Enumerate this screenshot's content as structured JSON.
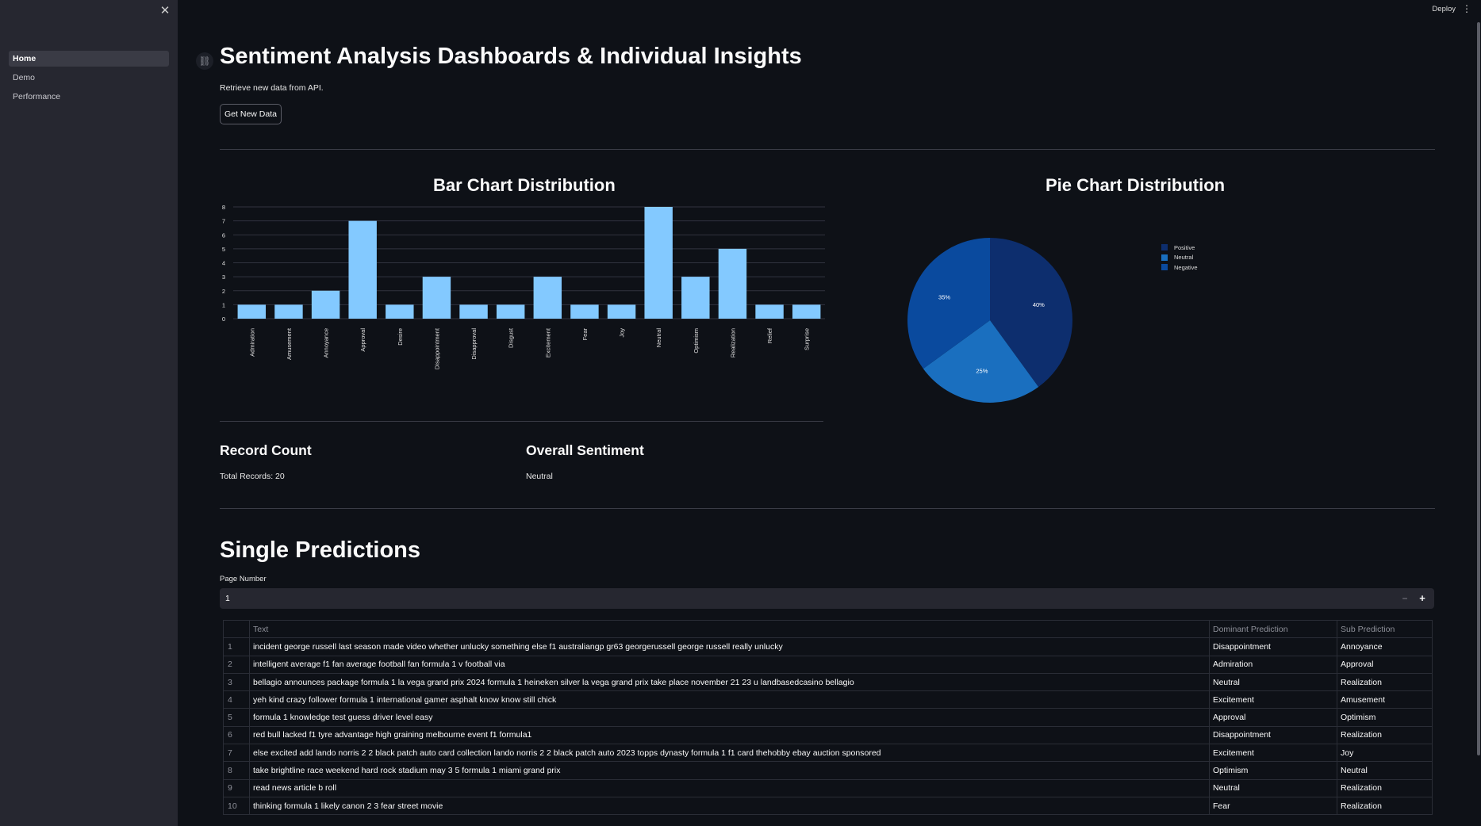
{
  "sidebar": {
    "items": [
      {
        "label": "Home",
        "active": true
      },
      {
        "label": "Demo",
        "active": false
      },
      {
        "label": "Performance",
        "active": false
      }
    ]
  },
  "topbar": {
    "deploy_label": "Deploy"
  },
  "header": {
    "title": "Sentiment Analysis Dashboards & Individual Insights",
    "subtitle": "Retrieve new data from API.",
    "button_label": "Get New Data"
  },
  "bar_chart_title": "Bar Chart Distribution",
  "pie_chart_title": "Pie Chart Distribution",
  "record_count": {
    "heading": "Record Count",
    "text": "Total Records: 20"
  },
  "overall_sentiment": {
    "heading": "Overall Sentiment",
    "text": "Neutral"
  },
  "single_predictions": {
    "heading": "Single Predictions",
    "page_label": "Page Number",
    "page_value": "1",
    "columns": [
      "Text",
      "Dominant Prediction",
      "Sub Prediction"
    ],
    "rows": [
      {
        "idx": "1",
        "text": "incident george russell last season made video whether unlucky something else f1 australiangp gr63 georgerussell george russell really unlucky",
        "dominant": "Disappointment",
        "sub": "Annoyance"
      },
      {
        "idx": "2",
        "text": "intelligent average f1 fan average football fan formula 1 v football via",
        "dominant": "Admiration",
        "sub": "Approval"
      },
      {
        "idx": "3",
        "text": "bellagio announces package formula 1 la vega grand prix 2024 formula 1 heineken silver la vega grand prix take place november 21 23 u landbasedcasino bellagio",
        "dominant": "Neutral",
        "sub": "Realization"
      },
      {
        "idx": "4",
        "text": "yeh kind crazy follower formula 1 international gamer asphalt know know still chick",
        "dominant": "Excitement",
        "sub": "Amusement"
      },
      {
        "idx": "5",
        "text": "formula 1 knowledge test guess driver level easy",
        "dominant": "Approval",
        "sub": "Optimism"
      },
      {
        "idx": "6",
        "text": "red bull lacked f1 tyre advantage high graining melbourne event f1 formula1",
        "dominant": "Disappointment",
        "sub": "Realization"
      },
      {
        "idx": "7",
        "text": "else excited add lando norris 2 2 black patch auto card collection lando norris 2 2 black patch auto 2023 topps dynasty formula 1 f1 card thehobby ebay auction sponsored",
        "dominant": "Excitement",
        "sub": "Joy"
      },
      {
        "idx": "8",
        "text": "take brightline race weekend hard rock stadium may 3 5 formula 1 miami grand prix",
        "dominant": "Optimism",
        "sub": "Neutral"
      },
      {
        "idx": "9",
        "text": "read news article b roll",
        "dominant": "Neutral",
        "sub": "Realization"
      },
      {
        "idx": "10",
        "text": "thinking formula 1 likely canon 2 3 fear street movie",
        "dominant": "Fear",
        "sub": "Realization"
      }
    ]
  },
  "chart_data": [
    {
      "type": "bar",
      "categories": [
        "Admiration",
        "Amusement",
        "Annoyance",
        "Approval",
        "Desire",
        "Disappointment",
        "Disapproval",
        "Disgust",
        "Excitement",
        "Fear",
        "Joy",
        "Neutral",
        "Optimism",
        "Realization",
        "Relief",
        "Surprise"
      ],
      "values": [
        1,
        1,
        2,
        7,
        1,
        3,
        1,
        1,
        3,
        1,
        1,
        8,
        3,
        5,
        1,
        1
      ],
      "ylim": [
        0,
        8
      ],
      "yticks": [
        0,
        1,
        2,
        3,
        4,
        5,
        6,
        7,
        8
      ],
      "grid": true,
      "color": "#83c9ff"
    },
    {
      "type": "pie",
      "labels": [
        "Positive",
        "Neutral",
        "Negative"
      ],
      "values": [
        40,
        25,
        35
      ],
      "value_labels": [
        "40%",
        "25%",
        "35%"
      ],
      "colors": [
        "#0d2e6e",
        "#1a6fbf",
        "#0a4a9e"
      ],
      "legend": "right"
    }
  ]
}
